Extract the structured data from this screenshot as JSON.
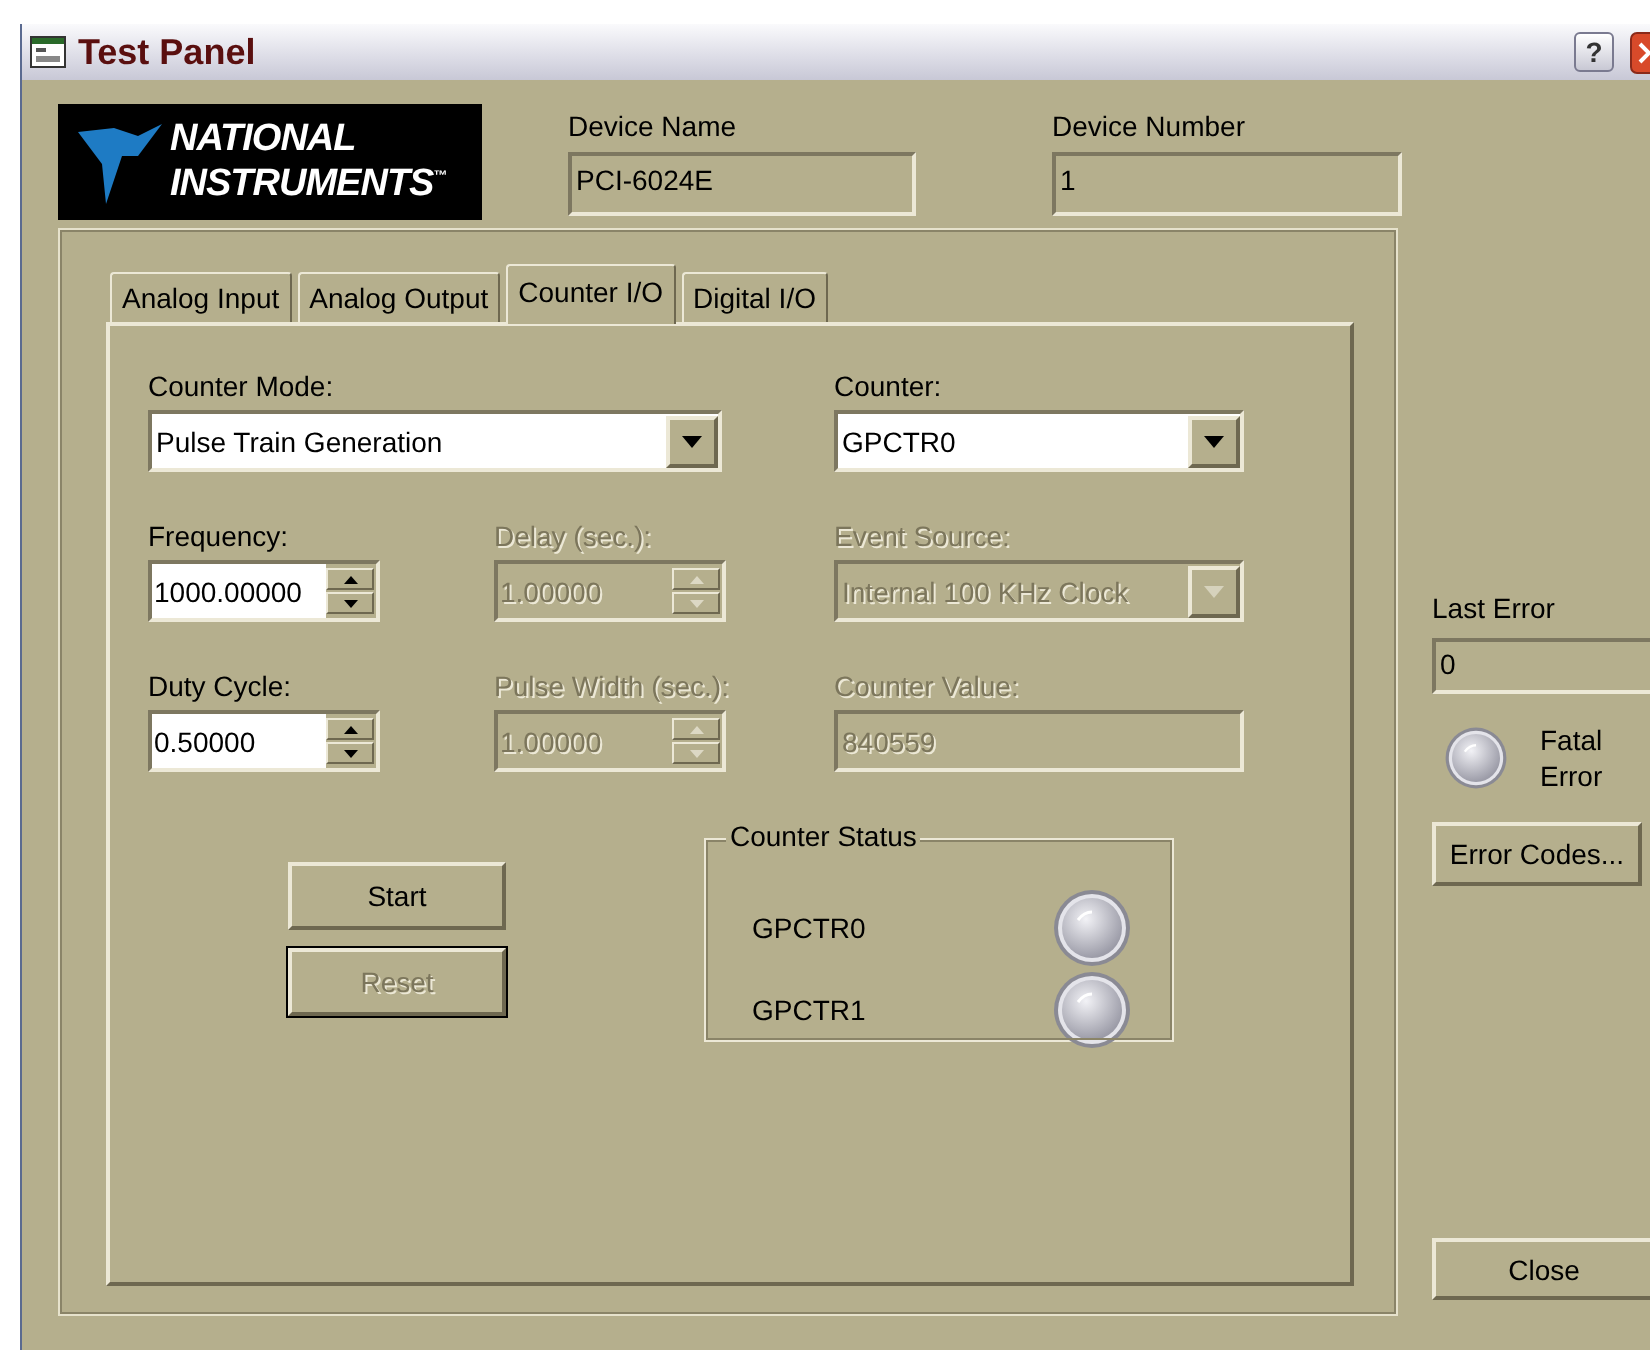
{
  "window": {
    "title": "Test Panel",
    "help_button": "?"
  },
  "logo": {
    "line_1": "NATIONAL",
    "line_2": "INSTRUMENTS$^{™}$"
  },
  "device_name": {
    "label": "Device Name",
    "value": "PCI-6024E"
  },
  "device_number": {
    "label": "Device Number",
    "value": "1"
  },
  "tabs": [
    {
      "label": "Analog Input",
      "selected": false
    },
    {
      "label": "Analog Output",
      "selected": false
    },
    {
      "label": "Counter I/O",
      "selected": true
    },
    {
      "label": "Digital I/O",
      "selected": false
    }
  ],
  "form_rows": [
    {
      "fields": [
        {
          "kind": "combo",
          "label": "Counter Mode:",
          "value": "Pulse Train Generation",
          "disabled": false
        },
        {
          "kind": "combo",
          "label": "Counter:",
          "value": "GPCTR0",
          "disabled": false
        }
      ]
    },
    {
      "fields": [
        {
          "kind": "spin",
          "label": "Frequency:",
          "value": "1000.00000",
          "disabled": false
        },
        {
          "kind": "spin",
          "label": "Delay (sec.):",
          "value": "1.00000",
          "disabled": true
        },
        {
          "kind": "combo",
          "label": "Event Source:",
          "value": "Internal 100 KHz Clock",
          "disabled": true
        }
      ]
    },
    {
      "fields": [
        {
          "kind": "spin",
          "label": "Duty Cycle:",
          "value": "0.50000",
          "disabled": false
        },
        {
          "kind": "spin",
          "label": "Pulse Width (sec.):",
          "value": "1.00000",
          "disabled": true
        },
        {
          "kind": "text",
          "label": "Counter Value:",
          "value": "840559",
          "disabled": true
        }
      ]
    }
  ],
  "buttons": [
    {
      "label": "Start",
      "disabled": false,
      "focused": false
    },
    {
      "label": "Reset",
      "disabled": true,
      "focused": true
    }
  ],
  "counter_status": {
    "title": "Counter Status",
    "counters": [
      {
        "label": "GPCTR0",
        "on": false
      },
      {
        "label": "GPCTR1",
        "on": false
      }
    ]
  },
  "last_error": {
    "label": "Last Error",
    "value": "0"
  },
  "fatal_error": {
    "label": "Fatal Error",
    "on": false
  },
  "error_codes_button": "Error Codes...",
  "close_button": "Close"
}
